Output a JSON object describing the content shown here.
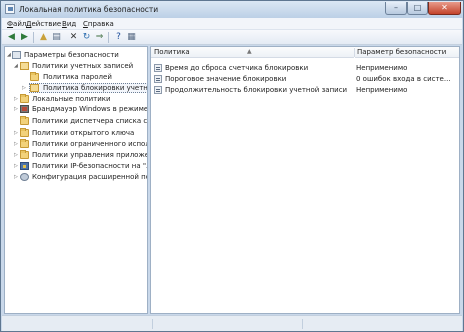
{
  "window": {
    "title": "Локальная политика безопасности",
    "controls": {
      "minimize": "–",
      "maximize": "□",
      "close": "✕"
    }
  },
  "menu": [
    "Файл",
    "Действие",
    "Вид",
    "Справка"
  ],
  "toolbar": [
    {
      "name": "back-arrow-icon",
      "glyph": "◀",
      "color": "#2f7a3a"
    },
    {
      "name": "forward-arrow-icon",
      "glyph": "▶",
      "color": "#2f7a3a"
    },
    {
      "name": "up-folder-icon",
      "glyph": "▲",
      "color": "#c9a13b"
    },
    {
      "name": "show-tree-icon",
      "glyph": "▤",
      "color": "#5a6d86"
    },
    {
      "name": "delete-icon",
      "glyph": "✕",
      "color": "#333333"
    },
    {
      "name": "refresh-icon",
      "glyph": "↻",
      "color": "#2f6fb0"
    },
    {
      "name": "export-list-icon",
      "glyph": "⇒",
      "color": "#3f6e3f"
    },
    {
      "name": "help-icon",
      "glyph": "?",
      "color": "#1e4e9c"
    },
    {
      "name": "properties-icon",
      "glyph": "▦",
      "color": "#5a6d86"
    }
  ],
  "tree": [
    {
      "label": "Параметры безопасности",
      "icon": "sec"
    },
    {
      "label": "Политики учетных записей",
      "icon": "folder-open",
      "expanded": true
    },
    {
      "label": "Политика паролей",
      "icon": "folder"
    },
    {
      "label": "Политика блокировки учетной з",
      "icon": "folder-open",
      "selected": true
    },
    {
      "label": "Локальные политики",
      "icon": "folder"
    },
    {
      "label": "Брандмауэр Windows в режиме по",
      "icon": "fw"
    },
    {
      "label": "Политики диспетчера списка сетей",
      "icon": "folder"
    },
    {
      "label": "Политики открытого ключа",
      "icon": "folder"
    },
    {
      "label": "Политики ограниченного использо",
      "icon": "folder"
    },
    {
      "label": "Политики управления приложения",
      "icon": "folder"
    },
    {
      "label": "Политики IP-безопасности на \"Лок",
      "icon": "ipsec"
    },
    {
      "label": "Конфигурация расширенной полити",
      "icon": "cfg"
    }
  ],
  "list": {
    "headers": {
      "policy": "Политика",
      "setting": "Параметр безопасности"
    },
    "rows": [
      {
        "policy": "Время до сброса счетчика блокировки",
        "setting": "Неприменимо"
      },
      {
        "policy": "Пороговое значение блокировки",
        "setting": "0 ошибок входа в систе..."
      },
      {
        "policy": "Продолжительность блокировки учетной записи",
        "setting": "Неприменимо"
      }
    ]
  }
}
